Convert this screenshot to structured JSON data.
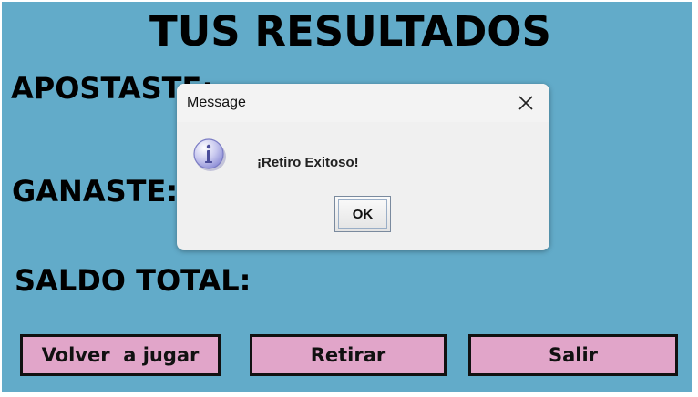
{
  "screen": {
    "title": "TUS RESULTADOS",
    "labels": {
      "apostaste": "APOSTASTE:",
      "ganaste": "GANASTE:",
      "saldo_total": "SALDO TOTAL:"
    },
    "buttons": {
      "volver": "Volver  a jugar",
      "retirar": "Retirar",
      "salir": "Salir"
    },
    "colors": {
      "background": "#62abc9",
      "button_fill": "#e1a5c9"
    }
  },
  "dialog": {
    "title": "Message",
    "message": "¡Retiro Exitoso!",
    "ok_label": "OK",
    "icon": "information-icon",
    "close_icon": "close-icon"
  }
}
